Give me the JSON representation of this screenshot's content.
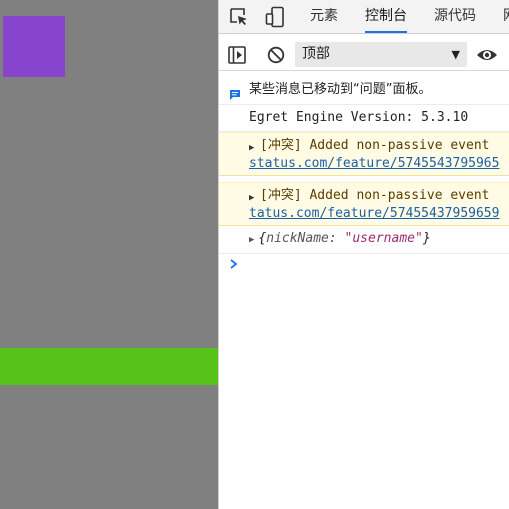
{
  "colors": {
    "canvas_bg": "#808080",
    "purple_square": "#8844cc",
    "green_bar": "#55c31a",
    "tab_accent": "#1a73e8",
    "warning_bg": "#fffbe5",
    "link": "#1a5fa8",
    "string_value": "#9e2b72"
  },
  "devtools": {
    "icons": {
      "inspect": "inspect-element-icon",
      "device": "device-toolbar-icon",
      "sidebar": "sidebar-toggle-icon",
      "clear": "clear-console-icon",
      "eye": "live-expression-icon",
      "info": "info-message-icon",
      "prompt": "prompt-chevron-icon"
    },
    "tabs": [
      "元素",
      "控制台",
      "源代码",
      "网"
    ],
    "active_tab": "控制台",
    "context": "顶部"
  },
  "console": {
    "info_message": "某些消息已移动到“问题”面板。",
    "egret_version": "Egret Engine Version: 5.3.10",
    "warnings": [
      {
        "line1": "[冲突] Added non-passive event",
        "line2": "status.com/feature/5745543795965"
      },
      {
        "line1": "[冲突] Added non-passive event",
        "line2": "tatus.com/feature/57455437959659"
      }
    ],
    "object_log": {
      "open": "{",
      "key": "nickName",
      "sep": ": ",
      "value": "\"username\"",
      "close": "}"
    }
  }
}
